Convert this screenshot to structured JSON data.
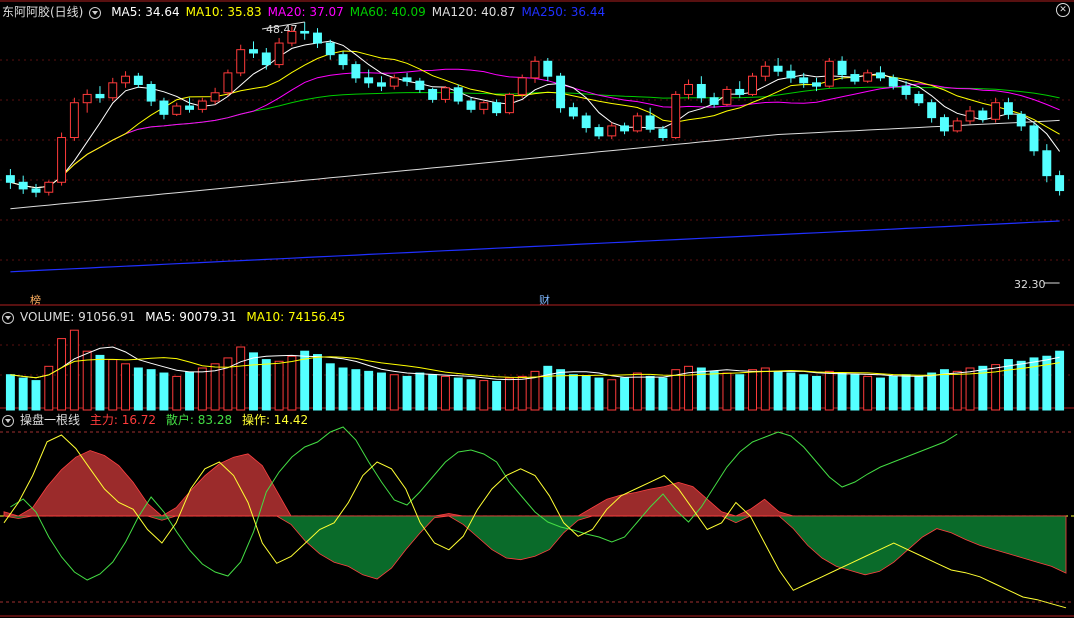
{
  "colors": {
    "up": "#ff3b3b",
    "down": "#54ffff",
    "ma5": "#ffffff",
    "ma10": "#ffff00",
    "ma20": "#ff00ff",
    "ma60": "#00cc00",
    "ma120": "#dddddd",
    "ma250": "#2030ff",
    "zhuli_fill": "#9b2b2b",
    "zhuli_neg_fill": "#0a6b2a",
    "sanhu": "#44dd44",
    "caozuo": "#ffff33"
  },
  "main_panel": {
    "stock": "东阿阿胶(日线)",
    "ma_labels": [
      {
        "text": "MA5: 34.64",
        "color": "#ffffff"
      },
      {
        "text": "MA10: 35.83",
        "color": "#ffff00"
      },
      {
        "text": "MA20: 37.07",
        "color": "#ff00ff"
      },
      {
        "text": "MA60: 40.09",
        "color": "#00cc00"
      },
      {
        "text": "MA120: 40.87",
        "color": "#dddddd"
      },
      {
        "text": "MA250: 36.44",
        "color": "#2030ff"
      }
    ],
    "high_label": "48.47",
    "low_label": "32.30",
    "tag_bang": "榜",
    "tag_cai": "财"
  },
  "volume_panel": {
    "title": "VOLUME: 91056.91",
    "ma5": "MA5: 90079.31",
    "ma10": "MA10: 74156.45"
  },
  "indicator_panel": {
    "title": "操盘一根线",
    "zhuli": "主力: 16.72",
    "sanhu": "散户: 83.28",
    "caozuo": "操作: 14.42"
  },
  "chart_data": [
    {
      "type": "candlestick",
      "title": "东阿阿胶(日线)",
      "series_note": "daily OHLC, approximate, 83 bars",
      "ohlc": [
        [
          39.2,
          39.6,
          38.4,
          38.8
        ],
        [
          38.8,
          39.2,
          38.1,
          38.4
        ],
        [
          38.4,
          38.7,
          37.9,
          38.2
        ],
        [
          38.2,
          38.9,
          38.0,
          38.8
        ],
        [
          38.8,
          41.8,
          38.6,
          41.5
        ],
        [
          41.5,
          43.9,
          41.3,
          43.6
        ],
        [
          43.6,
          44.4,
          43.0,
          44.1
        ],
        [
          44.1,
          44.6,
          43.6,
          43.9
        ],
        [
          43.9,
          45.1,
          43.7,
          44.8
        ],
        [
          44.8,
          45.5,
          44.5,
          45.2
        ],
        [
          45.2,
          45.4,
          44.5,
          44.7
        ],
        [
          44.7,
          44.9,
          43.4,
          43.7
        ],
        [
          43.7,
          43.9,
          42.6,
          42.9
        ],
        [
          42.9,
          43.6,
          42.8,
          43.4
        ],
        [
          43.4,
          43.9,
          43.0,
          43.2
        ],
        [
          43.2,
          43.9,
          43.0,
          43.7
        ],
        [
          43.7,
          44.5,
          43.5,
          44.2
        ],
        [
          44.2,
          45.6,
          44.0,
          45.4
        ],
        [
          45.4,
          47.1,
          45.2,
          46.8
        ],
        [
          46.8,
          47.3,
          46.3,
          46.6
        ],
        [
          46.6,
          46.9,
          45.6,
          45.9
        ],
        [
          45.9,
          47.5,
          45.7,
          47.2
        ],
        [
          47.2,
          48.2,
          47.0,
          47.9
        ],
        [
          47.9,
          48.47,
          47.4,
          47.8
        ],
        [
          47.8,
          48.1,
          46.9,
          47.2
        ],
        [
          47.2,
          47.4,
          46.2,
          46.5
        ],
        [
          46.5,
          46.7,
          45.6,
          45.9
        ],
        [
          45.9,
          46.1,
          44.8,
          45.1
        ],
        [
          45.1,
          45.6,
          44.5,
          44.8
        ],
        [
          44.8,
          45.2,
          44.3,
          44.6
        ],
        [
          44.6,
          45.3,
          44.4,
          45.1
        ],
        [
          45.1,
          45.4,
          44.6,
          44.9
        ],
        [
          44.9,
          45.1,
          44.2,
          44.4
        ],
        [
          44.4,
          44.5,
          43.6,
          43.8
        ],
        [
          43.8,
          44.6,
          43.6,
          44.5
        ],
        [
          44.5,
          44.7,
          43.5,
          43.7
        ],
        [
          43.7,
          43.9,
          43.0,
          43.2
        ],
        [
          43.2,
          43.7,
          42.9,
          43.6
        ],
        [
          43.6,
          43.8,
          42.8,
          43.0
        ],
        [
          43.0,
          44.2,
          42.9,
          44.1
        ],
        [
          44.1,
          45.3,
          43.9,
          45.1
        ],
        [
          45.1,
          46.4,
          44.8,
          46.1
        ],
        [
          46.1,
          46.3,
          44.9,
          45.2
        ],
        [
          45.2,
          45.4,
          43.0,
          43.3
        ],
        [
          43.3,
          43.6,
          42.6,
          42.8
        ],
        [
          42.8,
          43.0,
          41.8,
          42.1
        ],
        [
          42.1,
          42.3,
          41.4,
          41.6
        ],
        [
          41.6,
          42.4,
          41.4,
          42.2
        ],
        [
          42.2,
          42.4,
          41.7,
          41.9
        ],
        [
          41.9,
          43.0,
          41.8,
          42.8
        ],
        [
          42.8,
          43.3,
          41.8,
          42.0
        ],
        [
          42.0,
          42.2,
          41.3,
          41.5
        ],
        [
          41.5,
          44.3,
          41.4,
          44.1
        ],
        [
          44.1,
          45.0,
          43.8,
          44.7
        ],
        [
          44.7,
          45.2,
          43.6,
          43.9
        ],
        [
          43.9,
          44.2,
          43.3,
          43.5
        ],
        [
          43.5,
          44.6,
          43.4,
          44.4
        ],
        [
          44.4,
          44.9,
          43.9,
          44.1
        ],
        [
          44.1,
          45.4,
          44.0,
          45.2
        ],
        [
          45.2,
          46.1,
          44.9,
          45.8
        ],
        [
          45.8,
          46.3,
          45.2,
          45.5
        ],
        [
          45.5,
          45.9,
          44.8,
          45.1
        ],
        [
          45.1,
          45.4,
          44.5,
          44.8
        ],
        [
          44.8,
          45.1,
          44.3,
          44.6
        ],
        [
          44.6,
          46.3,
          44.5,
          46.1
        ],
        [
          46.1,
          46.4,
          45.0,
          45.3
        ],
        [
          45.3,
          45.6,
          44.7,
          44.9
        ],
        [
          44.9,
          45.6,
          44.8,
          45.4
        ],
        [
          45.4,
          45.8,
          44.9,
          45.1
        ],
        [
          45.1,
          45.3,
          44.4,
          44.6
        ],
        [
          44.6,
          44.9,
          43.8,
          44.1
        ],
        [
          44.1,
          44.3,
          43.4,
          43.6
        ],
        [
          43.6,
          43.8,
          42.4,
          42.7
        ],
        [
          42.7,
          42.9,
          41.6,
          41.9
        ],
        [
          41.9,
          42.7,
          41.8,
          42.5
        ],
        [
          42.5,
          43.4,
          42.3,
          43.1
        ],
        [
          43.1,
          43.3,
          42.4,
          42.6
        ],
        [
          42.6,
          43.9,
          42.4,
          43.6
        ],
        [
          43.6,
          43.9,
          42.6,
          42.9
        ],
        [
          42.9,
          43.1,
          41.9,
          42.2
        ],
        [
          42.2,
          42.4,
          40.4,
          40.7
        ],
        [
          40.7,
          41.1,
          38.8,
          39.2
        ],
        [
          39.2,
          39.5,
          38.0,
          38.3
        ]
      ],
      "ylim": [
        32.3,
        48.47
      ],
      "high_marker": 48.47,
      "low_marker": 32.3
    },
    {
      "type": "bar",
      "title": "VOLUME",
      "values": [
        42,
        38,
        35,
        52,
        85,
        95,
        70,
        65,
        60,
        55,
        50,
        48,
        44,
        40,
        45,
        50,
        55,
        62,
        75,
        68,
        60,
        58,
        64,
        70,
        66,
        55,
        50,
        48,
        46,
        44,
        42,
        40,
        44,
        42,
        40,
        38,
        36,
        35,
        34,
        38,
        40,
        46,
        52,
        48,
        42,
        40,
        38,
        36,
        38,
        44,
        40,
        38,
        48,
        52,
        50,
        46,
        44,
        42,
        48,
        50,
        46,
        44,
        42,
        40,
        46,
        44,
        42,
        40,
        38,
        40,
        42,
        40,
        44,
        48,
        46,
        50,
        52,
        54,
        60,
        58,
        62,
        64,
        70
      ],
      "ylim": [
        0,
        100
      ]
    },
    {
      "type": "area",
      "title": "操盘一根线",
      "series": [
        {
          "name": "主力",
          "values": [
            5,
            -3,
            10,
            35,
            55,
            70,
            78,
            72,
            60,
            40,
            15,
            -5,
            10,
            30,
            48,
            62,
            70,
            74,
            60,
            30,
            -10,
            -30,
            -45,
            -55,
            -60,
            -70,
            -75,
            -62,
            -40,
            -20,
            -2,
            3,
            -10,
            -25,
            -40,
            -50,
            -52,
            -48,
            -40,
            -20,
            -5,
            10,
            20,
            25,
            28,
            32,
            35,
            40,
            35,
            20,
            5,
            -8,
            8,
            20,
            5,
            -15,
            -35,
            -50,
            -60,
            -65,
            -70,
            -66,
            -55,
            -40,
            -25,
            -15,
            -20,
            -28,
            -35,
            -40,
            -45,
            -50,
            -55,
            -60,
            -68
          ],
          "color": "#9b2b2b"
        },
        {
          "name": "散户",
          "values": [
            95,
            103,
            90,
            65,
            45,
            30,
            22,
            28,
            40,
            60,
            85,
            105,
            90,
            70,
            52,
            38,
            30,
            26,
            40,
            70,
            110,
            130,
            145,
            155,
            160,
            170,
            175,
            162,
            140,
            120,
            102,
            97,
            110,
            125,
            140,
            150,
            152,
            148,
            140,
            120,
            105,
            90,
            80,
            75,
            72,
            68,
            65,
            60,
            65,
            80,
            95,
            108,
            92,
            80,
            95,
            115,
            135,
            150,
            160,
            165,
            170,
            166,
            155,
            140,
            125,
            115,
            120,
            128,
            135,
            140,
            145,
            150,
            155,
            160,
            168
          ],
          "color": "#44dd44"
        },
        {
          "name": "操作",
          "values": [
            -5,
            10,
            30,
            55,
            60,
            50,
            35,
            20,
            10,
            5,
            -10,
            -20,
            -5,
            20,
            35,
            40,
            30,
            10,
            -20,
            -35,
            -30,
            -20,
            -10,
            -5,
            10,
            30,
            40,
            35,
            20,
            -5,
            -20,
            -25,
            -15,
            5,
            20,
            30,
            35,
            30,
            15,
            -5,
            -15,
            -10,
            5,
            15,
            20,
            25,
            30,
            20,
            5,
            -10,
            -5,
            10,
            0,
            -20,
            -40,
            -55,
            -50,
            -45,
            -40,
            -35,
            -30,
            -25,
            -20,
            -25,
            -30,
            -35,
            -40,
            -42,
            -45,
            -50,
            -55,
            -60,
            -62,
            -65,
            -68
          ],
          "color": "#ffff33"
        }
      ]
    }
  ]
}
